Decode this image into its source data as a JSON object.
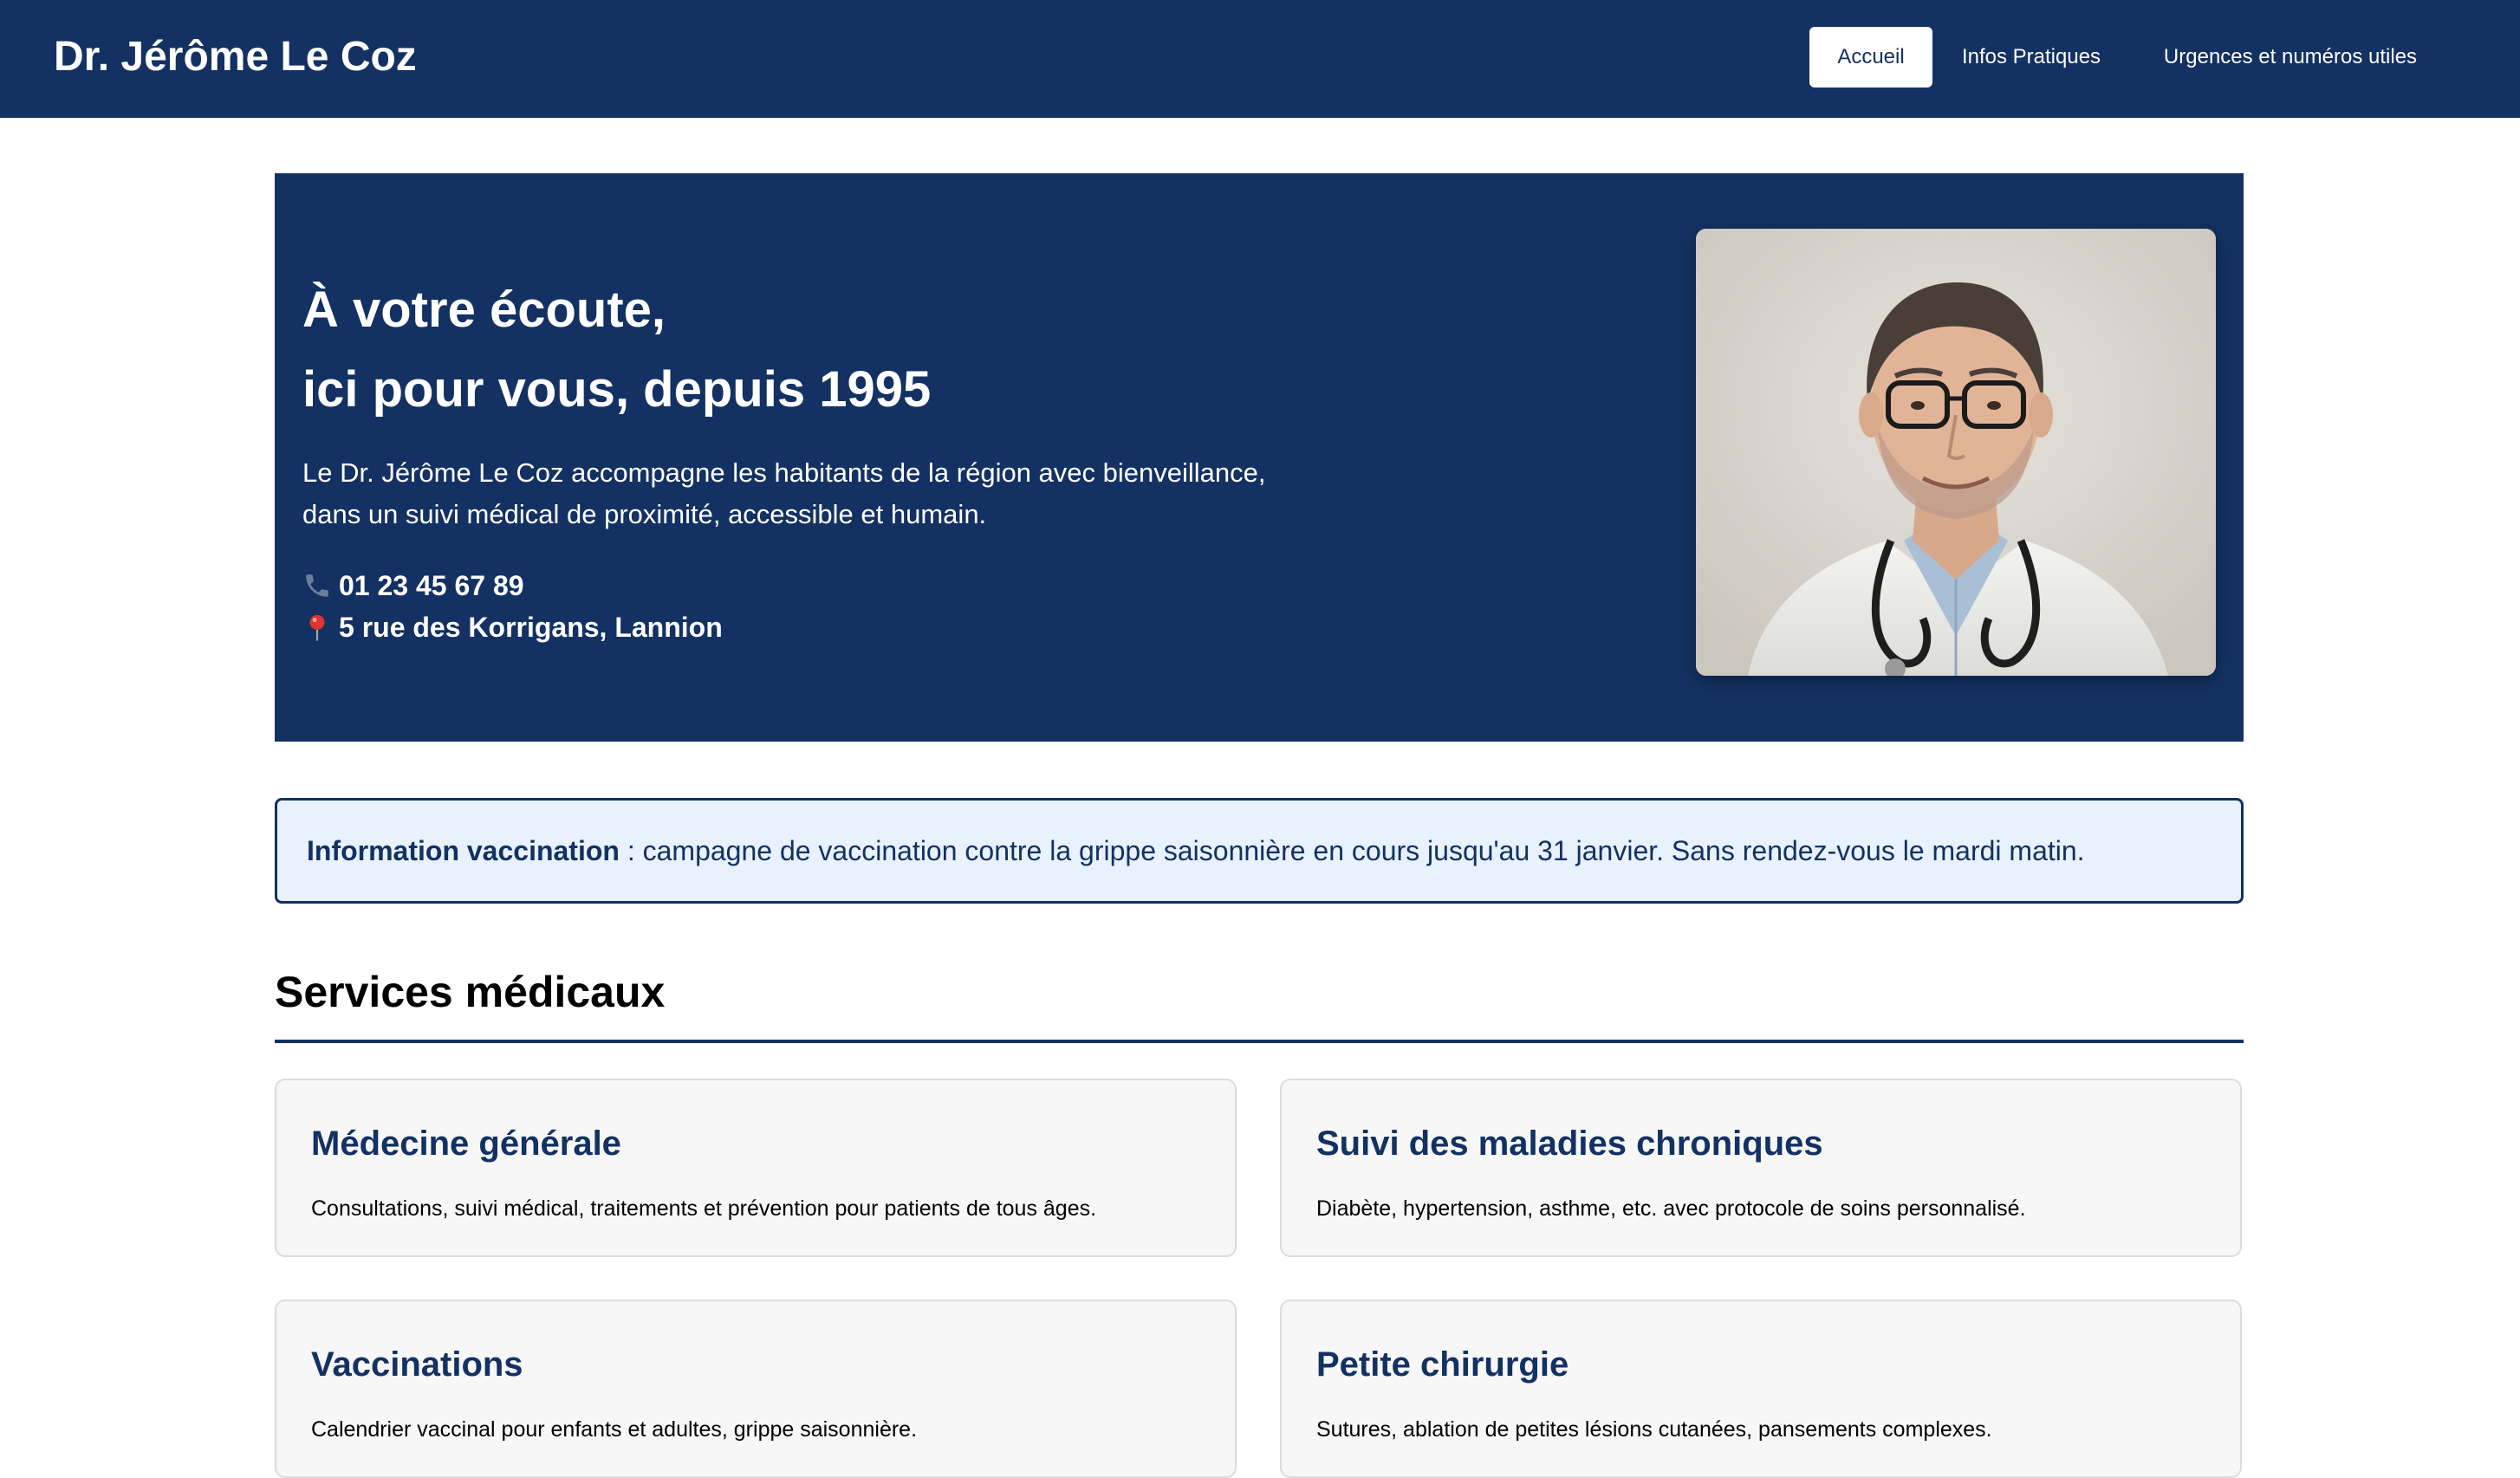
{
  "header": {
    "brand": "Dr. Jérôme Le Coz",
    "nav": [
      {
        "label": "Accueil",
        "active": true
      },
      {
        "label": "Infos Pratiques",
        "active": false
      },
      {
        "label": "Urgences et numéros utiles",
        "active": false
      }
    ]
  },
  "hero": {
    "title_line1": "À votre écoute,",
    "title_line2": "ici pour vous, depuis 1995",
    "text_line1": "Le Dr. Jérôme Le Coz accompagne les habitants de la région avec bienveillance,",
    "text_line2": "dans un suivi médical de proximité, accessible et humain.",
    "phone": "01 23 45 67 89",
    "address": "5 rue des Korrigans, Lannion",
    "phone_icon": "phone-icon",
    "address_icon": "map-pin-icon"
  },
  "notice": {
    "label": "Information vaccination",
    "text": " : campagne de vaccination contre la grippe saisonnière en cours jusqu'au 31 janvier. Sans rendez-vous le mardi matin."
  },
  "services": {
    "title": "Services médicaux",
    "cards": [
      {
        "title": "Médecine générale",
        "desc": "Consultations, suivi médical, traitements et prévention pour patients de tous âges."
      },
      {
        "title": "Suivi des maladies chroniques",
        "desc": "Diabète, hypertension, asthme, etc. avec protocole de soins personnalisé."
      },
      {
        "title": "Vaccinations",
        "desc": "Calendrier vaccinal pour enfants et adultes, grippe saisonnière."
      },
      {
        "title": "Petite chirurgie",
        "desc": "Sutures, ablation de petites lésions cutanées, pansements complexes."
      }
    ]
  },
  "colors": {
    "primary": "#133162",
    "notice_bg": "#e8f1fc",
    "card_bg": "#f7f7f7"
  }
}
